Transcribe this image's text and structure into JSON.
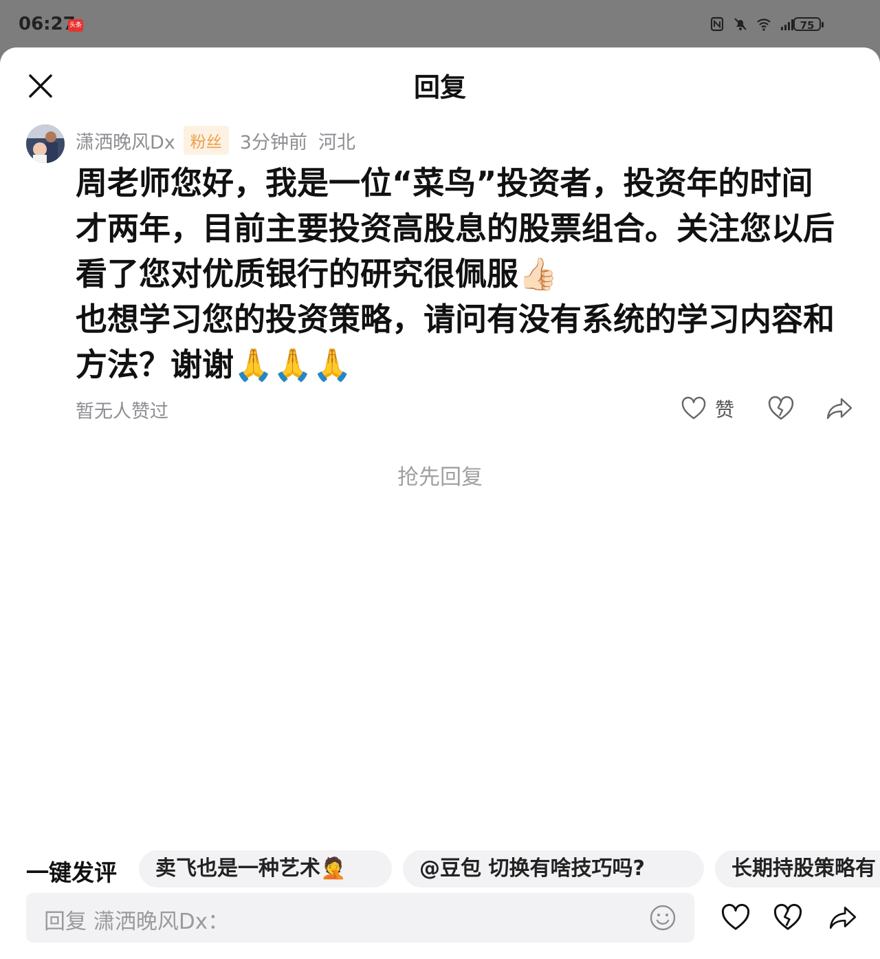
{
  "status_bar": {
    "time": "06:27",
    "app_badge": "头条",
    "battery": "75",
    "icons": [
      "nfc-icon",
      "mute-icon",
      "wifi-icon",
      "signal-icon",
      "battery-icon"
    ]
  },
  "header": {
    "title": "回复",
    "close_icon": "close-icon"
  },
  "comment": {
    "author": "潇洒晚风Dx",
    "badge": "粉丝",
    "time_ago": "3分钟前",
    "region": "河北",
    "text": "周老师您好，我是一位“菜鸟”投资者，投资年的时间才两年，目前主要投资高股息的股票组合。关注您以后 看了您对优质银行的研究很佩服👍🏻\n也想学习您的投资策略，请问有没有系统的学习内容和方法？谢谢🙏🙏🙏",
    "likes_status": "暂无人赞过",
    "like_label": "赞"
  },
  "empty_state": "抢先回复",
  "quick_replies": {
    "label": "一键发评",
    "chips": [
      "卖飞也是一种艺术🤦",
      "@豆包 切换有啥技巧吗?",
      "长期持股策略有"
    ]
  },
  "composer": {
    "placeholder": "回复 潇洒晚风Dx："
  },
  "colors": {
    "badge_bg": "#fdf1e2",
    "badge_text": "#e9a04c",
    "meta_gray": "#8e8e93",
    "status_bar_bg": "#7d7d7d"
  }
}
